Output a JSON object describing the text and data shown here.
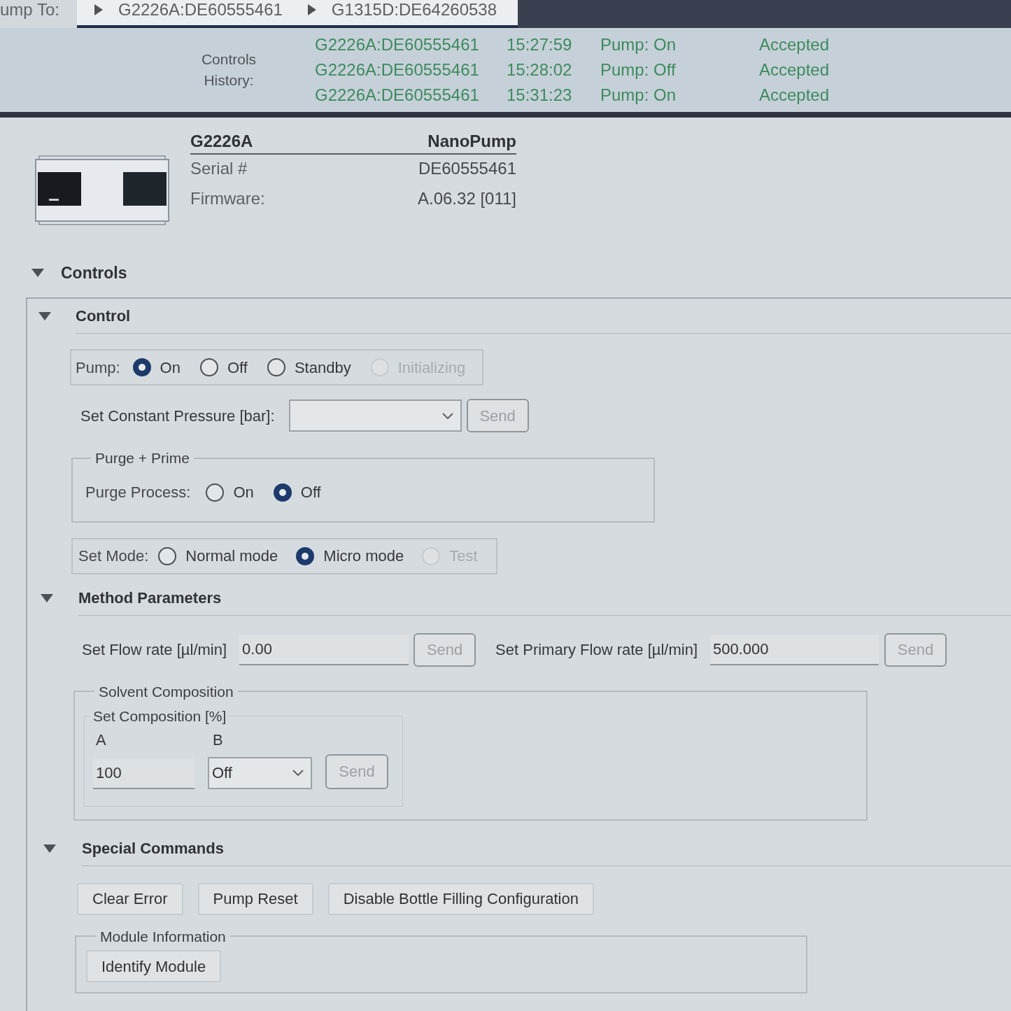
{
  "jump_bar": {
    "label": "ump To:",
    "tabs": [
      {
        "label": "G2226A:DE60555461"
      },
      {
        "label": "G1315D:DE64260538"
      }
    ]
  },
  "controls_history": {
    "label": "Controls History:",
    "rows": [
      {
        "module": "G2226A:DE60555461",
        "time": "15:27:59",
        "action": "Pump: On",
        "status": "Accepted"
      },
      {
        "module": "G2226A:DE60555461",
        "time": "15:28:02",
        "action": "Pump: Off",
        "status": "Accepted"
      },
      {
        "module": "G2226A:DE60555461",
        "time": "15:31:23",
        "action": "Pump: On",
        "status": "Accepted"
      }
    ]
  },
  "device": {
    "model": "G2226A",
    "name": "NanoPump",
    "fields": [
      {
        "label": "Serial #",
        "value": "DE60555461"
      },
      {
        "label": "Firmware:",
        "value": "A.06.32 [011]"
      }
    ]
  },
  "controls": {
    "title": "Controls",
    "expanded": true
  },
  "control": {
    "title": "Control",
    "expanded": true,
    "pump": {
      "label": "Pump:",
      "options": [
        {
          "label": "On",
          "selected": true,
          "disabled": false
        },
        {
          "label": "Off",
          "selected": false,
          "disabled": false
        },
        {
          "label": "Standby",
          "selected": false,
          "disabled": false
        },
        {
          "label": "Initializing",
          "selected": false,
          "disabled": true
        }
      ]
    },
    "constant_pressure": {
      "label": "Set Constant Pressure [bar]:",
      "send": {
        "label": "Send",
        "disabled": true
      }
    },
    "purge_prime": {
      "title": "Purge + Prime",
      "label": "Purge Process:",
      "options": [
        {
          "label": "On",
          "selected": false,
          "disabled": false
        },
        {
          "label": "Off",
          "selected": true,
          "disabled": false
        }
      ]
    },
    "mode": {
      "label": "Set Mode:",
      "options": [
        {
          "label": "Normal mode",
          "selected": false,
          "disabled": false
        },
        {
          "label": "Micro mode",
          "selected": true,
          "disabled": false
        },
        {
          "label": "Test",
          "selected": false,
          "disabled": true
        }
      ]
    }
  },
  "method_parameters": {
    "title": "Method Parameters",
    "expanded": true,
    "flow_rate": {
      "label": "Set Flow rate [µl/min]",
      "value": "0.00",
      "send": {
        "label": "Send",
        "disabled": true
      }
    },
    "primary_flow_rate": {
      "label": "Set Primary Flow rate [µl/min]",
      "value": "500.000",
      "send": {
        "label": "Send",
        "disabled": true
      }
    },
    "solvent_composition": {
      "title": "Solvent Composition",
      "set_composition": {
        "title": "Set Composition [%]",
        "a": {
          "label": "A",
          "value": "100"
        },
        "b": {
          "label": "B",
          "value": "Off"
        },
        "send": {
          "label": "Send",
          "disabled": true
        }
      }
    }
  },
  "special_commands": {
    "title": "Special Commands",
    "expanded": true,
    "buttons": [
      {
        "label": "Clear Error",
        "disabled": false
      },
      {
        "label": "Pump Reset",
        "disabled": false
      },
      {
        "label": "Disable Bottle Filling Configuration",
        "disabled": false
      }
    ],
    "module_information": {
      "title": "Module Information",
      "button": {
        "label": "Identify Module",
        "disabled": false
      }
    }
  }
}
